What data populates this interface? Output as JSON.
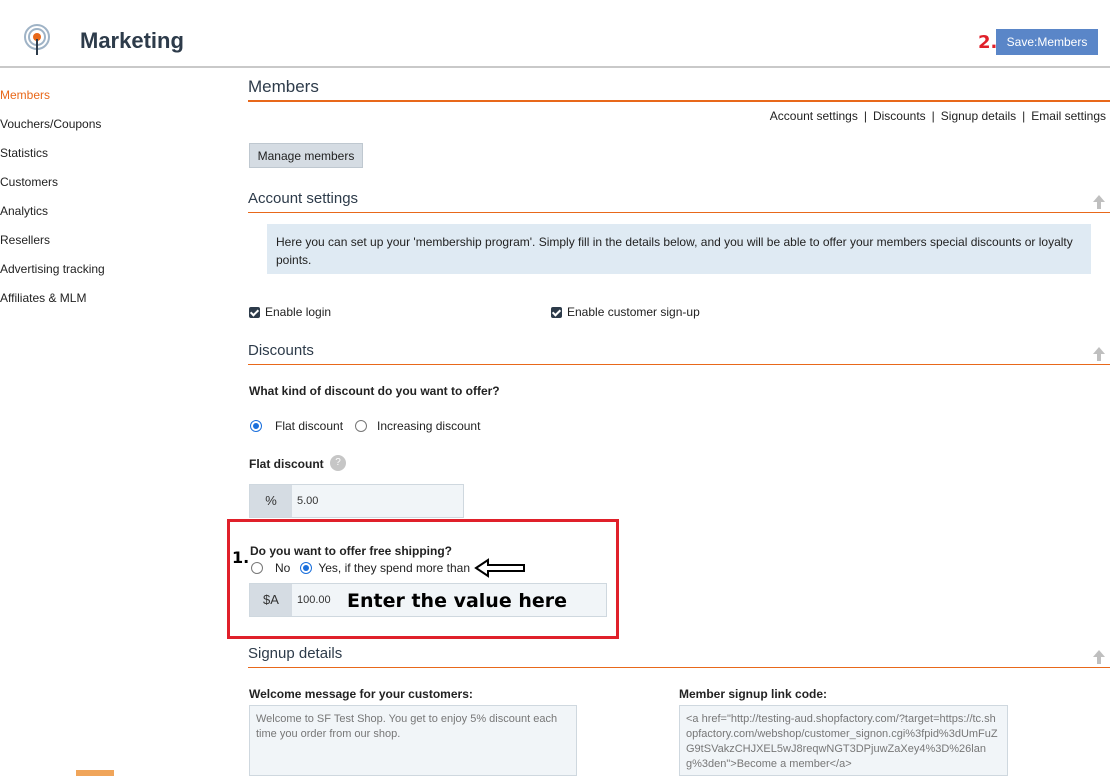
{
  "header": {
    "title": "Marketing",
    "step2_label": "2.",
    "save_label": "Save:Members"
  },
  "sidebar": {
    "items": [
      {
        "label": "Members",
        "active": true
      },
      {
        "label": "Vouchers/Coupons"
      },
      {
        "label": "Statistics"
      },
      {
        "label": "Customers"
      },
      {
        "label": "Analytics"
      },
      {
        "label": "Resellers"
      },
      {
        "label": "Advertising tracking"
      },
      {
        "label": "Affiliates & MLM"
      }
    ]
  },
  "members": {
    "title": "Members",
    "nav": [
      "Account settings",
      "Discounts",
      "Signup details",
      "Email settings"
    ],
    "manage_label": "Manage members"
  },
  "account": {
    "title": "Account settings",
    "info": "Here you can set up your 'membership program'. Simply fill in the details below, and you will be able to offer your members special discounts or loyalty points.",
    "enable_login": "Enable login",
    "enable_signup": "Enable customer sign-up"
  },
  "discounts": {
    "title": "Discounts",
    "question": "What kind of discount do you want to offer?",
    "flat_option": "Flat discount",
    "increasing_option": "Increasing discount",
    "flat_label": "Flat discount",
    "help": "?",
    "percent_prefix": "%",
    "percent_value": "5.00",
    "shipping_question": "Do you want to offer free shipping?",
    "no_option": "No",
    "yes_option": "Yes, if they spend more than",
    "currency_prefix": "$A",
    "amount_value": "100.00",
    "step1_label": "1.",
    "enter_hint": "Enter the value here"
  },
  "signup": {
    "title": "Signup details",
    "welcome_label": "Welcome message for your customers:",
    "welcome_text": "Welcome to SF Test Shop. You get to enjoy 5% discount each time you order from our shop.",
    "link_label": "Member signup link code:",
    "link_code": "<a href=\"http://testing-aud.shopfactory.com/?target=https://tc.shopfactory.com/webshop/customer_signon.cgi%3fpid%3dUmFuZG9tSVakzCHJXEL5wJ8reqwNGT3DPjuwZaXey4%3D%26lang%3den\">Become a member</a>"
  },
  "colors": {
    "accent": "#e8681a",
    "save_button": "#5a86c8",
    "highlight": "#e0202a",
    "radio": "#1a6fdc"
  }
}
